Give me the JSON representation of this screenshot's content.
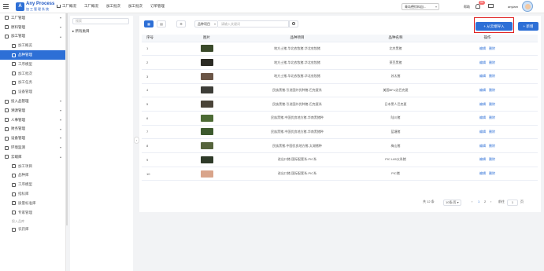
{
  "header": {
    "logo_title": "Any Process",
    "logo_subtitle": "加工管理系统",
    "nav": [
      "工厂概况",
      "工厂概况",
      "加工批次",
      "加工批次",
      "订单管理"
    ],
    "dept_select": "青岛德饮料自...",
    "help": "帮助",
    "notif_count": "99",
    "username": "anylam"
  },
  "sidebar": {
    "items": [
      {
        "label": "工厂管理",
        "chev": "▾"
      },
      {
        "label": "原料管理",
        "chev": "▾"
      },
      {
        "label": "加工管理",
        "chev": "▴"
      },
      {
        "label": "加工概览",
        "sub": true
      },
      {
        "label": "品种管理",
        "sub": true,
        "active": true
      },
      {
        "label": "工序模型",
        "sub": true
      },
      {
        "label": "加工批次",
        "sub": true
      },
      {
        "label": "加工任务",
        "sub": true
      },
      {
        "label": "设备管理",
        "sub": true
      },
      {
        "label": "投入品管理",
        "chev": "▾"
      },
      {
        "label": "溯源管理",
        "chev": "▾"
      },
      {
        "label": "人事管理",
        "chev": "▾"
      },
      {
        "label": "财务管理",
        "chev": "▾"
      },
      {
        "label": "设备管理",
        "chev": "▾"
      },
      {
        "label": "环境监测",
        "chev": "▾"
      },
      {
        "label": "云端库",
        "chev": "▴"
      },
      {
        "label": "加工项目",
        "sub": true
      },
      {
        "label": "品种库",
        "sub": true
      },
      {
        "label": "工序模型",
        "sub": true
      },
      {
        "label": "指标库",
        "sub": true
      },
      {
        "label": "质量标准库",
        "sub": true
      },
      {
        "label": "专家管理",
        "sub": true
      }
    ],
    "caption": "投入品库",
    "last_item": "农药库"
  },
  "tree": {
    "search_placeholder": "搜索",
    "root_label": "所有类目"
  },
  "toolbar": {
    "filter_select": "品种项目",
    "search_placeholder": "请输入关键词",
    "import_button": "+ 从云端导入",
    "add_button": "+ 新增"
  },
  "table": {
    "columns": [
      "序号",
      "图片",
      "品种项目",
      "品种名称",
      "操作"
    ],
    "edit_label": "编辑",
    "delete_label": "删除",
    "rows": [
      {
        "seq": "1",
        "project": "地方土猪-华北农牧猪-华北农牧猪",
        "name": "北京黑猪",
        "color": "#3a4a2a"
      },
      {
        "seq": "2",
        "project": "地方土猪-华北农牧猪-华北农牧猪",
        "name": "莱芜黑猪",
        "color": "#2b2b24"
      },
      {
        "seq": "3",
        "project": "地方土猪-华北农牧猪-华北农牧猪",
        "name": "苏太猪",
        "color": "#6b5546"
      },
      {
        "seq": "4",
        "project": "民族黑猪-引进国外优种猪-巴克夏系",
        "name": "美国BFU边巴克夏",
        "color": "#3d3d38"
      },
      {
        "seq": "5",
        "project": "民族黑猪-引进国外优种猪-巴克夏系",
        "name": "日本黑人巴克夏",
        "color": "#4a4438"
      },
      {
        "seq": "6",
        "project": "民族黑猪-中国优良地方猪-华南黑猪种",
        "name": "陆川猪",
        "color": "#4d6b35"
      },
      {
        "seq": "7",
        "project": "民族黑猪-中国优良地方猪-华南黑猪种",
        "name": "蓝塘猪",
        "color": "#3d5a2e"
      },
      {
        "seq": "8",
        "project": "民族黑猪-中国优良地方猪-太湖猪种",
        "name": "梅山猪",
        "color": "#56643c"
      },
      {
        "seq": "9",
        "project": "进出口猪-国际配套系-PIC系",
        "name": "PIC L65父系猪",
        "color": "#2e3a28"
      },
      {
        "seq": "10",
        "project": "进出口猪-国际配套系-PIC系",
        "name": "PIC猪",
        "color": "#d9a48a"
      }
    ]
  },
  "pager": {
    "total": "共 12 条",
    "page_size": "10条/页",
    "pages": [
      "1",
      "2"
    ],
    "goto_label": "前往",
    "goto_value": "1",
    "page_unit": "页"
  },
  "colors": {
    "primary": "#2d6fd6",
    "highlight_box": "#e02020"
  }
}
